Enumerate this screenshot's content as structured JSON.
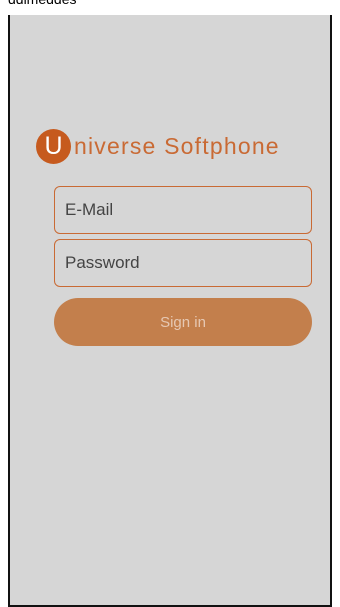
{
  "caption": "ddimeddes",
  "app": {
    "logo_letter": "U",
    "logo_text": "niverse Softphone",
    "brand_color": "#c65a1e",
    "accent_color": "#c96a34",
    "background_color": "#d6d6d6"
  },
  "login": {
    "email_placeholder": "E-Mail",
    "email_value": "",
    "password_placeholder": "Password",
    "password_value": "",
    "signin_label": "Sign in"
  }
}
